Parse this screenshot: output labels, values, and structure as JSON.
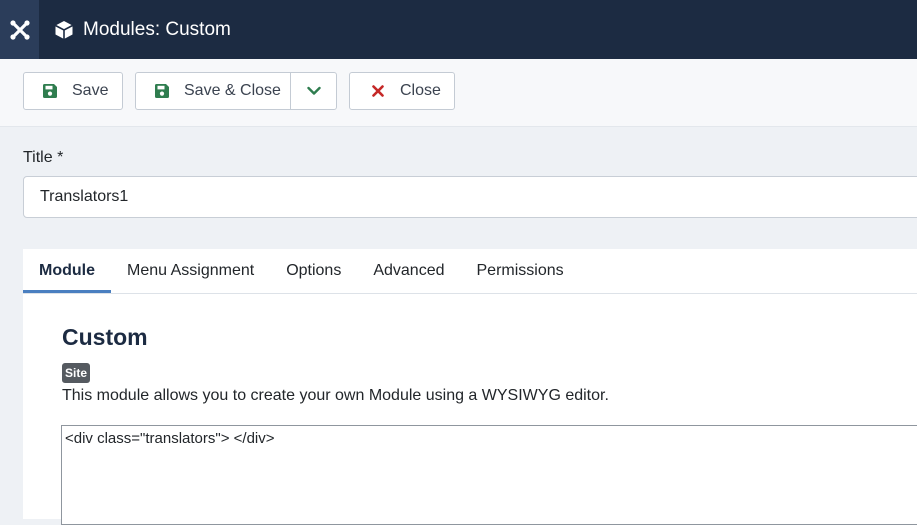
{
  "header": {
    "title": "Modules: Custom",
    "logo_icon": "joomla-logo",
    "title_icon": "cube-icon"
  },
  "toolbar": {
    "save_label": "Save",
    "save_close_label": "Save & Close",
    "close_label": "Close"
  },
  "form": {
    "title_label": "Title *",
    "title_value": "Translators1"
  },
  "tabs": [
    {
      "label": "Module",
      "active": true
    },
    {
      "label": "Menu Assignment",
      "active": false
    },
    {
      "label": "Options",
      "active": false
    },
    {
      "label": "Advanced",
      "active": false
    },
    {
      "label": "Permissions",
      "active": false
    }
  ],
  "module": {
    "heading": "Custom",
    "badge": "Site",
    "description": "This module allows you to create your own Module using a WYSIWYG editor.",
    "content": "<div class=\"translators\"> </div>"
  },
  "colors": {
    "header_bg": "#1c2b42",
    "save_icon": "#2f7d4f",
    "close_icon": "#c52827",
    "active_tab": "#4a7fc0"
  }
}
